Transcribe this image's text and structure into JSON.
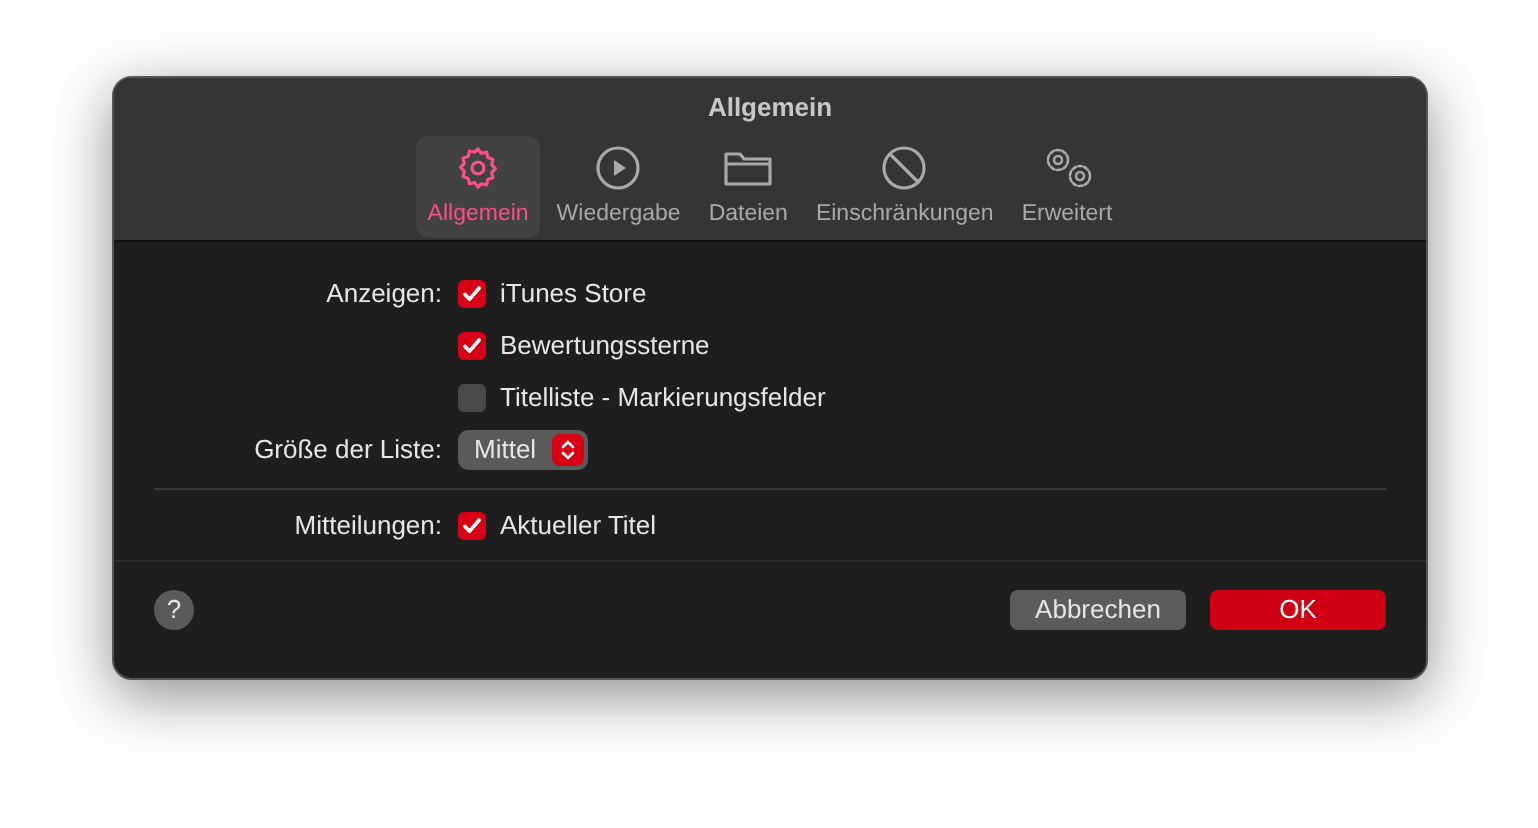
{
  "window": {
    "title": "Allgemein"
  },
  "tabs": [
    {
      "label": "Allgemein",
      "kind": "gear",
      "selected": true
    },
    {
      "label": "Wiedergabe",
      "kind": "play",
      "selected": false
    },
    {
      "label": "Dateien",
      "kind": "folder",
      "selected": false
    },
    {
      "label": "Einschränkungen",
      "kind": "block",
      "selected": false
    },
    {
      "label": "Erweitert",
      "kind": "gears",
      "selected": false
    }
  ],
  "show": {
    "label": "Anzeigen:",
    "options": [
      {
        "label": "iTunes Store",
        "checked": true
      },
      {
        "label": "Bewertungssterne",
        "checked": true
      },
      {
        "label": "Titelliste - Markierungsfelder",
        "checked": false
      }
    ]
  },
  "list_size": {
    "label": "Größe der Liste:",
    "value": "Mittel"
  },
  "notifications": {
    "label": "Mitteilungen:",
    "options": [
      {
        "label": "Aktueller Titel",
        "checked": true
      }
    ]
  },
  "footer": {
    "help": "?",
    "buttons": [
      {
        "label": "Abbrechen",
        "kind": "secondary"
      },
      {
        "label": "OK",
        "kind": "primary"
      }
    ]
  }
}
